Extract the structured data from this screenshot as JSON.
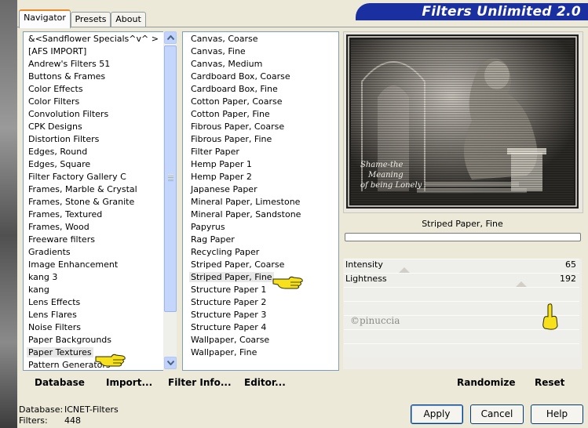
{
  "app": {
    "title": "Filters Unlimited 2.0"
  },
  "tabs": [
    {
      "label": "Navigator",
      "active": true
    },
    {
      "label": "Presets",
      "active": false
    },
    {
      "label": "About",
      "active": false
    }
  ],
  "categories": [
    "&<Sandflower Specials^v^ >",
    "[AFS IMPORT]",
    "Andrew's Filters 51",
    "Buttons & Frames",
    "Color Effects",
    "Color Filters",
    "Convolution Filters",
    "CPK Designs",
    "Distortion Filters",
    "Edges, Round",
    "Edges, Square",
    "Filter Factory Gallery C",
    "Frames, Marble & Crystal",
    "Frames, Stone & Granite",
    "Frames, Textured",
    "Frames, Wood",
    "Freeware filters",
    "Gradients",
    "Image Enhancement",
    "kang 3",
    "kang",
    "Lens Effects",
    "Lens Flares",
    "Noise Filters",
    "Paper Backgrounds",
    "Paper Textures",
    "Pattern Generators"
  ],
  "selected_category": "Paper Textures",
  "filters": [
    "Canvas, Coarse",
    "Canvas, Fine",
    "Canvas, Medium",
    "Cardboard Box, Coarse",
    "Cardboard Box, Fine",
    "Cotton Paper, Coarse",
    "Cotton Paper, Fine",
    "Fibrous Paper, Coarse",
    "Fibrous Paper, Fine",
    "Filter Paper",
    "Hemp Paper 1",
    "Hemp Paper 2",
    "Japanese Paper",
    "Mineral Paper, Limestone",
    "Mineral Paper, Sandstone",
    "Papyrus",
    "Rag Paper",
    "Recycling Paper",
    "Striped Paper, Coarse",
    "Striped Paper, Fine",
    "Structure Paper 1",
    "Structure Paper 2",
    "Structure Paper 3",
    "Structure Paper 4",
    "Wallpaper, Coarse",
    "Wallpaper, Fine"
  ],
  "selected_filter": "Striped Paper, Fine",
  "preview": {
    "filter_name": "Striped Paper, Fine",
    "caption_lines": [
      "Shame-the",
      "Meaning",
      "of being Lonely"
    ]
  },
  "sliders": [
    {
      "label": "Intensity",
      "value": "65",
      "fraction": 0.255
    },
    {
      "label": "Lightness",
      "value": "192",
      "fraction": 0.753
    }
  ],
  "watermark": "©pinuccia",
  "buttons": {
    "database": "Database",
    "import": "Import...",
    "filter_info": "Filter Info...",
    "editor": "Editor...",
    "randomize": "Randomize",
    "reset": "Reset",
    "apply": "Apply",
    "cancel": "Cancel",
    "help": "Help"
  },
  "status": {
    "database_label": "Database:",
    "database_value": "ICNET-Filters",
    "filters_label": "Filters:",
    "filters_value": "448"
  },
  "colors": {
    "banner": "#1a2fa0",
    "tab_highlight": "#e68b2c",
    "pointer_hand": "#f7e11d"
  },
  "icons": [
    "scroll-up-icon",
    "scroll-down-icon",
    "scroll-grip-icon",
    "pointing-hand-icon"
  ]
}
